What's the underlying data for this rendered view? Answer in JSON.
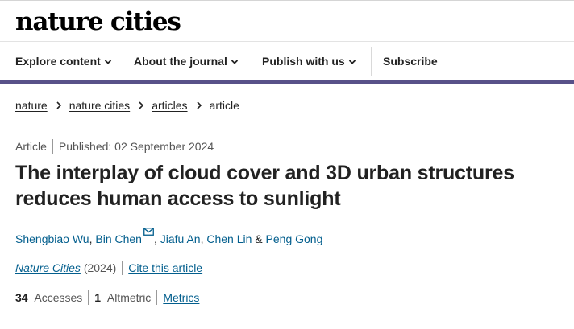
{
  "header": {
    "logo": "nature cities",
    "nav": [
      {
        "label": "Explore content",
        "dropdown": true
      },
      {
        "label": "About the journal",
        "dropdown": true
      },
      {
        "label": "Publish with us",
        "dropdown": true
      },
      {
        "label": "Subscribe",
        "dropdown": false
      }
    ],
    "accent_color": "#585189"
  },
  "breadcrumb": [
    "nature",
    "nature cities",
    "articles",
    "article"
  ],
  "article": {
    "type": "Article",
    "published": "Published: 02 September 2024",
    "title": "The interplay of cloud cover and 3D urban structures reduces human access to sunlight",
    "authors": [
      "Shengbiao Wu",
      "Bin Chen",
      "Jiafu An",
      "Chen Lin",
      "Peng Gong"
    ],
    "author_separator_last": "&",
    "corresponding_icon": "mail-icon",
    "journal": "Nature Cities",
    "year": "(2024)",
    "cite_label": "Cite this article",
    "accesses_count": "34",
    "accesses_label": "Accesses",
    "altmetric_count": "1",
    "altmetric_label": "Altmetric",
    "metrics_label": "Metrics",
    "link_color": "#025e8d"
  }
}
